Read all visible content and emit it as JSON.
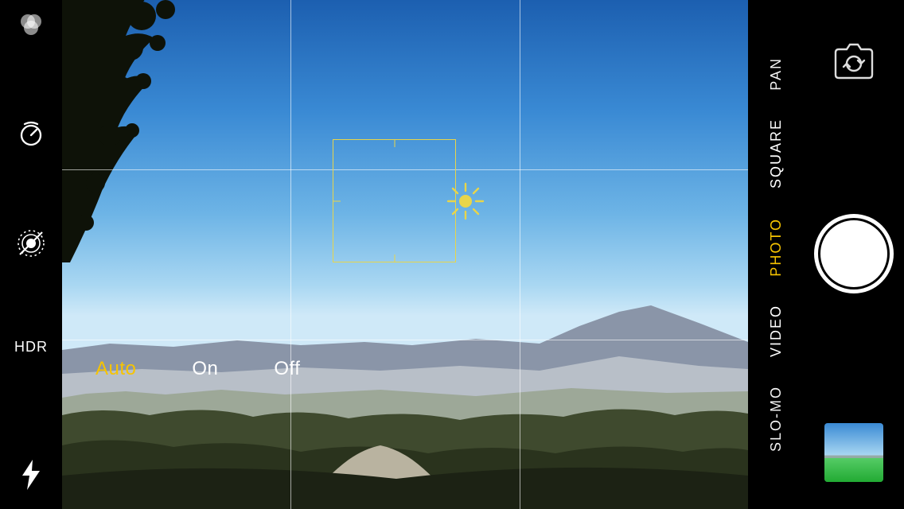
{
  "left_toolbar": {
    "filters_icon": "filters-icon",
    "timer_icon": "timer-icon",
    "live_photo_icon": "live-photo-off-icon",
    "hdr_label": "HDR",
    "flash_icon": "flash-icon"
  },
  "hdr_options": {
    "auto": "Auto",
    "on": "On",
    "off": "Off",
    "selected": "Auto"
  },
  "modes": {
    "items": [
      {
        "label": "PAN",
        "active": false,
        "partial": true
      },
      {
        "label": "SQUARE",
        "active": false,
        "partial": false
      },
      {
        "label": "PHOTO",
        "active": true,
        "partial": false
      },
      {
        "label": "VIDEO",
        "active": false,
        "partial": false
      },
      {
        "label": "SLO-MO",
        "active": false,
        "partial": true
      }
    ]
  },
  "right_bar": {
    "switch_camera_icon": "switch-camera-icon",
    "shutter": "shutter-button",
    "thumbnail": "last-photo-thumbnail"
  },
  "focus": {
    "indicator": "focus-exposure-box",
    "exposure_icon": "sun-exposure-icon"
  },
  "colors": {
    "accent": "#f7c400",
    "focus_box": "#e8d54a"
  }
}
